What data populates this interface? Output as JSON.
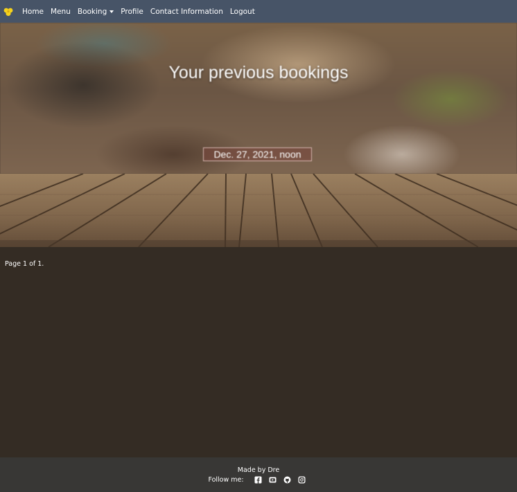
{
  "navbar": {
    "brand_color": "#f5d21c",
    "items": [
      {
        "label": "Home"
      },
      {
        "label": "Menu"
      },
      {
        "label": "Booking"
      },
      {
        "label": "Profile"
      },
      {
        "label": "Contact Information"
      },
      {
        "label": "Logout"
      }
    ]
  },
  "hero": {
    "title": "Your previous bookings",
    "bookings": [
      {
        "datetime": "Dec. 27, 2021, noon"
      }
    ]
  },
  "pagination": {
    "text": "Page 1 of 1."
  },
  "footer": {
    "made_by": "Made by Dre",
    "follow_label": "Follow me:",
    "social_icons": [
      "facebook-icon",
      "youtube-icon",
      "github-icon",
      "instagram-icon"
    ]
  },
  "colors": {
    "navbar_bg": "#475467",
    "page_bg": "#342c24",
    "footer_bg": "#383735",
    "booking_border": "#d6b6b0"
  }
}
